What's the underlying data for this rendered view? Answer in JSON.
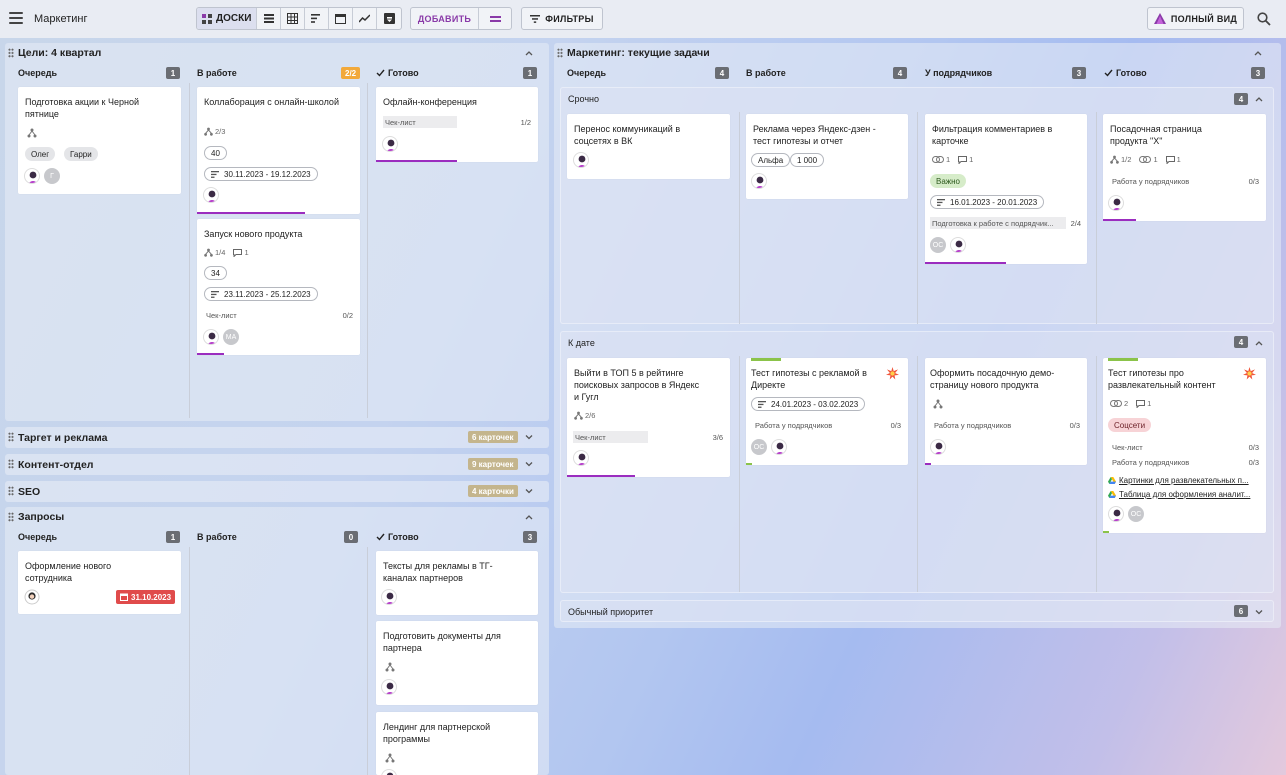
{
  "app": {
    "title": "Маркетинг"
  },
  "toolbar": {
    "boards_label": "ДОСКИ",
    "add_label": "ДОБАВИТЬ",
    "filters_label": "ФИЛЬТРЫ",
    "full_view_label": "ПОЛНЫЙ ВИД"
  },
  "left": {
    "q4": {
      "title": "Цели: 4 квартал",
      "cols": [
        {
          "label": "Очередь",
          "count": "1"
        },
        {
          "label": "В работе",
          "count": "2/2"
        },
        {
          "label": "Готово",
          "count": "1"
        }
      ],
      "cards": {
        "c1": {
          "title": "Подготовка акции к Черной пятнице",
          "tags": [
            "Олег",
            "Гарри"
          ],
          "avatar2": "Г"
        },
        "c2": {
          "title": "Коллаборация с онлайн-школой",
          "subtasks": "2/3",
          "number": "40",
          "dates": "30.11.2023 - 19.12.2023",
          "progress": 0.67
        },
        "c3": {
          "title": "Запуск нового продукта",
          "subtasks": "1/4",
          "comments": "1",
          "number": "34",
          "dates": "23.11.2023 - 25.12.2023",
          "checklist_label": "Чек-лист",
          "checklist_value": "0/2",
          "avatar2": "МА",
          "progress": 0.17
        },
        "c4": {
          "title": "Офлайн-конференция",
          "checklist_label": "Чек-лист",
          "checklist_value": "1/2",
          "progress": 0.5
        }
      }
    },
    "collapsed": [
      {
        "title": "Таргет и реклама",
        "badge": "6 карточек"
      },
      {
        "title": "Контент-отдел",
        "badge": "9 карточек"
      },
      {
        "title": "SEO",
        "badge": "4 карточки"
      }
    ],
    "req": {
      "title": "Запросы",
      "cols": [
        {
          "label": "Очередь",
          "count": "1"
        },
        {
          "label": "В работе",
          "count": "0"
        },
        {
          "label": "Готово",
          "count": "3"
        }
      ],
      "cards": {
        "r1": {
          "title": "Оформление нового сотрудника",
          "due": "31.10.2023"
        },
        "r2": {
          "title": "Тексты для рекламы в ТГ-каналах партнеров"
        },
        "r3": {
          "title": "Подготовить документы для партнера"
        },
        "r4": {
          "title": "Лендинг для партнерской программы"
        }
      }
    }
  },
  "right": {
    "title": "Маркетинг: текущие задачи",
    "cols": [
      {
        "label": "Очередь",
        "count": "4"
      },
      {
        "label": "В работе",
        "count": "4"
      },
      {
        "label": "У подрядчиков",
        "count": "3"
      },
      {
        "label": "Готово",
        "count": "3"
      }
    ],
    "groups": {
      "urgent": {
        "title": "Срочно",
        "count": "4"
      },
      "bydate": {
        "title": "К дате",
        "count": "4"
      },
      "normal": {
        "title": "Обычный приоритет",
        "count": "6"
      }
    },
    "cards": {
      "u1": {
        "title": "Перенос коммуникаций в соцсетях в ВК"
      },
      "u2": {
        "title": "Реклама через Яндекс-дзен - тест гипотезы и отчет",
        "tag": "Альфа",
        "number": "1 000"
      },
      "u3": {
        "title": "Фильтрация комментариев в карточке",
        "links": "1",
        "comments": "1",
        "tag": "Важно",
        "dates": "16.01.2023 - 20.01.2023",
        "checklist_label": "Подготовка к работе с подрядчик...",
        "checklist_value": "2/4",
        "avatar1": "ОС",
        "progress": 0.5
      },
      "u4": {
        "title": "Посадочная страница продукта \"Х\"",
        "subtasks": "1/2",
        "links": "1",
        "comments": "1",
        "checklist_label": "Работа у подрядчиков",
        "checklist_value": "0/3",
        "progress": 0.2
      },
      "d1": {
        "title": "Выйти в ТОП 5 в рейтинге поисковых запросов в Яндекс и Гугл",
        "subtasks": "2/6",
        "checklist_label": "Чек-лист",
        "checklist_value": "3/6",
        "progress": 0.42
      },
      "d2": {
        "title": "Тест гипотезы с рекламой в Директе",
        "dates": "24.01.2023 - 03.02.2023",
        "checklist_label": "Работа у подрядчиков",
        "checklist_value": "0/3",
        "avatar1": "ОС",
        "progress": 0.04
      },
      "d3": {
        "title": "Оформить посадочную демо-страницу нового продукта",
        "checklist_label": "Работа у подрядчиков",
        "checklist_value": "0/3",
        "progress": 0.04
      },
      "d4": {
        "title": "Тест гипотезы про развлекательный контент",
        "links": "2",
        "comments": "1",
        "tag": "Соцсети",
        "checklist1_label": "Чек-лист",
        "checklist1_value": "0/3",
        "checklist2_label": "Работа у подрядчиков",
        "checklist2_value": "0/3",
        "link1": "Картинки для развлекательных п...",
        "link2": "Таблица для оформления аналит...",
        "avatar2": "ОС"
      }
    }
  },
  "colors": {
    "accent": "#9b2dbf",
    "due": "#e04b4b",
    "count_bg": "#6a6d73",
    "count_orange": "#f2a93b",
    "tag_green": "#8bc34a"
  }
}
